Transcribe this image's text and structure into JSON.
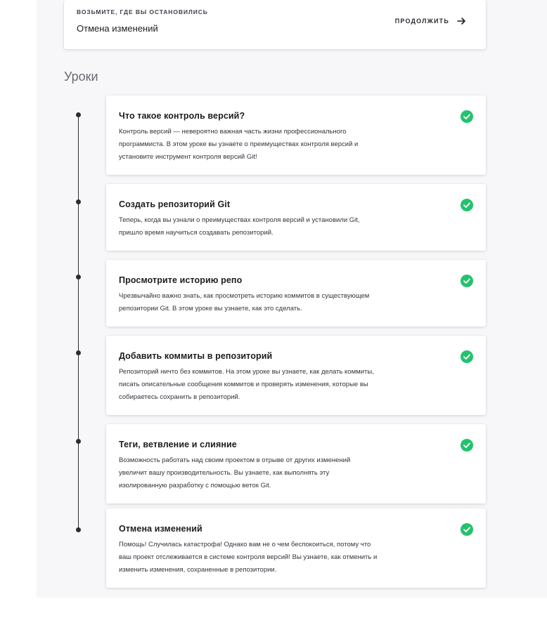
{
  "resume": {
    "kicker": "ВОЗЬМИТЕ, ГДЕ ВЫ ОСТАНОВИЛИСЬ",
    "title": "Отмена изменений",
    "cta_label": "ПРОДОЛЖИТЬ",
    "cta_icon": "arrow-right-icon"
  },
  "section": {
    "title": "Уроки"
  },
  "colors": {
    "check": "#25c26e",
    "timeline": "#2c2c33",
    "background": "#f7f7f9"
  },
  "lessons": [
    {
      "title": "Что такое контроль версий?",
      "desc": "Контроль версий — невероятно важная часть жизни профессионального программиста. В этом уроке вы узнаете о преимуществах контроля версий и установите инструмент контроля версий Git!",
      "status": "completed",
      "status_icon": "check-circle-icon"
    },
    {
      "title": "Создать репозиторий Git",
      "desc": "Теперь, когда вы узнали о преимуществах контроля версий и установили Git, пришло время научиться создавать репозиторий.",
      "status": "completed",
      "status_icon": "check-circle-icon"
    },
    {
      "title": "Просмотрите историю репо",
      "desc": "Чрезвычайно важно знать, как просмотреть историю коммитов в существующем репозитории Git. В этом уроке вы узнаете, как это сделать.",
      "status": "completed",
      "status_icon": "check-circle-icon"
    },
    {
      "title": "Добавить коммиты в репозиторий",
      "desc": "Репозиторий ничто без коммитов. На этом уроке вы узнаете, как делать коммиты, писать описательные сообщения коммитов и проверять изменения, которые вы собираетесь сохранить в репозиторий.",
      "status": "completed",
      "status_icon": "check-circle-icon"
    },
    {
      "title": "Теги, ветвление и слияние",
      "desc": "Возможность работать над своим проектом в отрыве от других изменений увеличит вашу производительность. Вы узнаете, как выполнять эту изолированную разработку с помощью веток Git.",
      "status": "completed",
      "status_icon": "check-circle-icon"
    },
    {
      "title": "Отмена изменений",
      "desc": "Помощь! Случилась катастрофа! Однако вам не о чем беспокоиться, потому что ваш проект отслеживается в системе контроля версий! Вы узнаете, как отменить и изменить изменения, сохраненные в репозитории.",
      "status": "completed",
      "status_icon": "check-circle-icon"
    }
  ]
}
